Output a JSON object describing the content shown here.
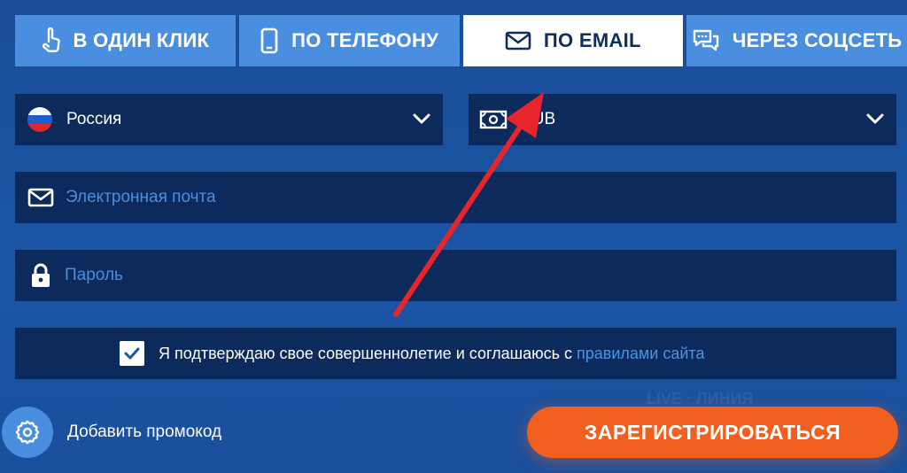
{
  "colors": {
    "accent_blue": "#4a8fdf",
    "field_bg": "#0c2b5c",
    "register_orange": "#f25f1e",
    "annotation_arrow": "#e8252a"
  },
  "tabs": [
    {
      "label": "В ОДИН КЛИК",
      "icon": "hand-pointer-icon",
      "active": false
    },
    {
      "label": "ПО ТЕЛЕФОНУ",
      "icon": "phone-icon",
      "active": false
    },
    {
      "label": "ПО EMAIL",
      "icon": "envelope-icon",
      "active": true
    },
    {
      "label": "ЧЕРЕЗ СОЦСЕТЬ",
      "icon": "chat-bubbles-icon",
      "active": false
    }
  ],
  "form": {
    "country": {
      "value": "Россия",
      "icon": "russia-flag-icon"
    },
    "currency": {
      "value": "RUB",
      "icon": "banknote-icon"
    },
    "email": {
      "placeholder": "Электронная почта",
      "icon": "envelope-icon"
    },
    "password": {
      "placeholder": "Пароль",
      "icon": "lock-icon"
    },
    "agree": {
      "checked": true,
      "text": "Я подтверждаю свое совершеннолетие и соглашаюсь с",
      "link": "правилами сайта"
    }
  },
  "promo": {
    "label": "Добавить промокод",
    "icon": "gear-icon"
  },
  "register": {
    "label": "ЗАРЕГИСТРИРОВАТЬСЯ"
  }
}
